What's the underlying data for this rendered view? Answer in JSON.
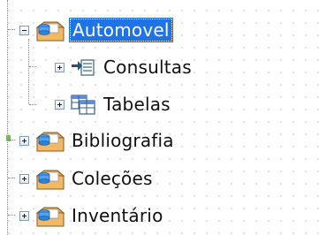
{
  "tree": {
    "nodes": [
      {
        "label": "Automovel",
        "state": "expanded",
        "icon": "database-icon",
        "selected": true
      },
      {
        "label": "Consultas",
        "state": "collapsed",
        "icon": "queries-icon"
      },
      {
        "label": "Tabelas",
        "state": "collapsed",
        "icon": "tables-icon"
      },
      {
        "label": "Bibliografia",
        "state": "collapsed",
        "icon": "database-icon"
      },
      {
        "label": "Coleções",
        "state": "collapsed",
        "icon": "database-icon"
      },
      {
        "label": "Inventário",
        "state": "collapsed",
        "icon": "database-icon"
      }
    ]
  },
  "colors": {
    "selection": "#1e73e8",
    "expander_border": "#7f9db9",
    "grid_dots": "#c9c9c9"
  }
}
